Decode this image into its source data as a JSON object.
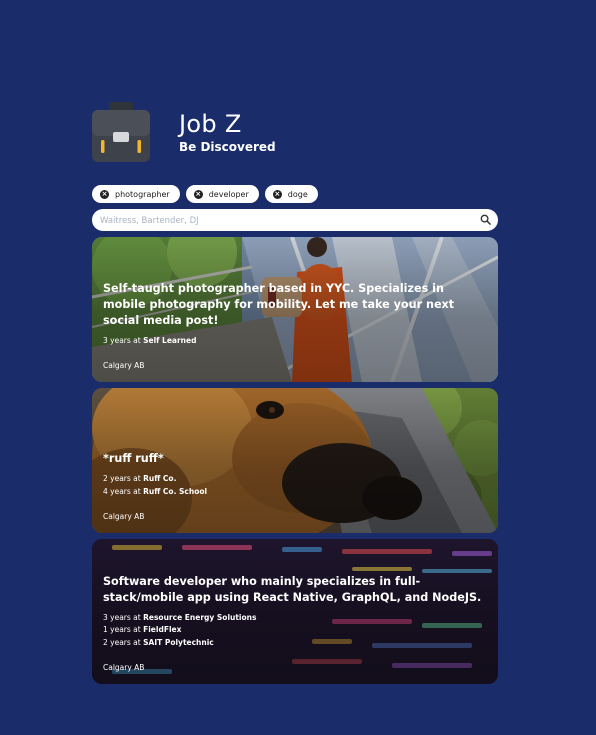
{
  "app": {
    "title": "Job Z",
    "subtitle": "Be Discovered"
  },
  "filters": [
    {
      "label": "photographer",
      "icon": "close-circle-icon"
    },
    {
      "label": "developer",
      "icon": "close-circle-icon"
    },
    {
      "label": "doge",
      "icon": "close-circle-icon"
    }
  ],
  "search": {
    "placeholder": "Waitress, Bartender, DJ",
    "value": "",
    "icon": "search-icon"
  },
  "cards": [
    {
      "title": "Self-taught photographer based in YYC. Specializes in mobile photography for mobility. Let me take your next social media post!",
      "experience": [
        {
          "duration": "3 years at",
          "org": "Self Learned"
        }
      ],
      "location": "Calgary AB"
    },
    {
      "title": "*ruff ruff*",
      "experience": [
        {
          "duration": "2 years at",
          "org": "Ruff Co."
        },
        {
          "duration": "4 years at",
          "org": "Ruff Co. School"
        }
      ],
      "location": "Calgary AB"
    },
    {
      "title": "Software developer who mainly specializes in full-stack/mobile app using React Native, GraphQL, and NodeJS.",
      "experience": [
        {
          "duration": "3 years at",
          "org": "Resource Energy Solutions"
        },
        {
          "duration": "1 years at",
          "org": "FieldFlex"
        },
        {
          "duration": "2 years at",
          "org": "SAIT Polytechnic"
        }
      ],
      "location": "Calgary AB"
    }
  ],
  "colors": {
    "background": "#1b2c6b",
    "chip": "#ffffff",
    "briefcase": "#3a3f47",
    "briefcase_clasp": "#f2b72c"
  }
}
